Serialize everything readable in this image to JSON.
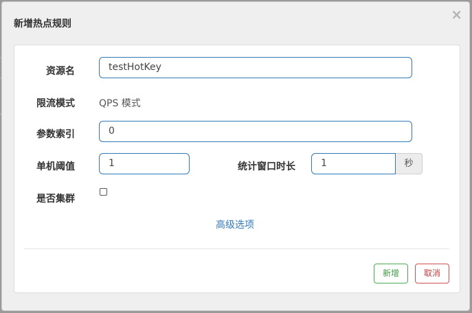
{
  "modal": {
    "title": "新增热点规则",
    "close_icon": "×"
  },
  "form": {
    "resource_name": {
      "label": "资源名",
      "value": "testHotKey"
    },
    "flow_mode": {
      "label": "限流模式",
      "value": "QPS 模式"
    },
    "param_index": {
      "label": "参数索引",
      "value": "0"
    },
    "threshold": {
      "label": "单机阈值",
      "value": "1"
    },
    "stat_window": {
      "label": "统计窗口时长",
      "value": "1",
      "unit": "秒"
    },
    "cluster": {
      "label": "是否集群",
      "checked": false
    },
    "advanced_link": "高级选项"
  },
  "footer": {
    "add_label": "新增",
    "cancel_label": "取消"
  },
  "colors": {
    "input_border": "#2f79b7",
    "link": "#337ab7",
    "add_button": "#4aa84e",
    "cancel_button": "#d05050"
  }
}
